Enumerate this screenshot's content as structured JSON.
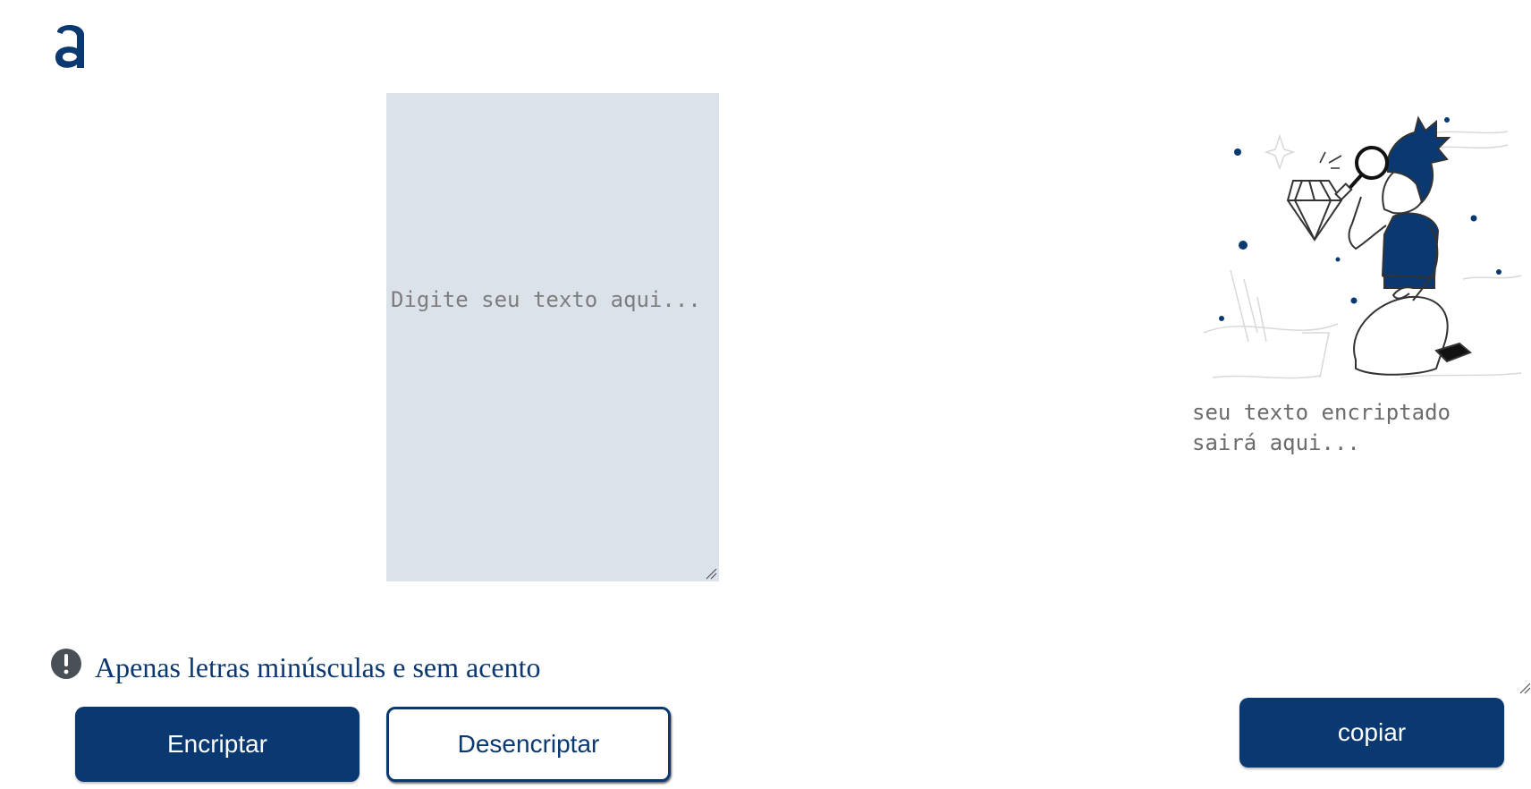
{
  "logo": {
    "icon": "alura-logo-icon"
  },
  "input": {
    "placeholder": "Digite seu texto aqui..."
  },
  "output": {
    "illustration": "person-with-magnifier-illustration",
    "placeholder": "seu texto encriptado sairá aqui..."
  },
  "warning": {
    "icon": "exclamation-circle-icon",
    "text": "Apenas letras minúsculas e sem acento"
  },
  "buttons": {
    "encrypt": "Encriptar",
    "decrypt": "Desencriptar",
    "copy": "copiar"
  },
  "colors": {
    "primary": "#0a3871",
    "input_bg": "#dce2ea",
    "placeholder_text": "#7d7d7d"
  }
}
